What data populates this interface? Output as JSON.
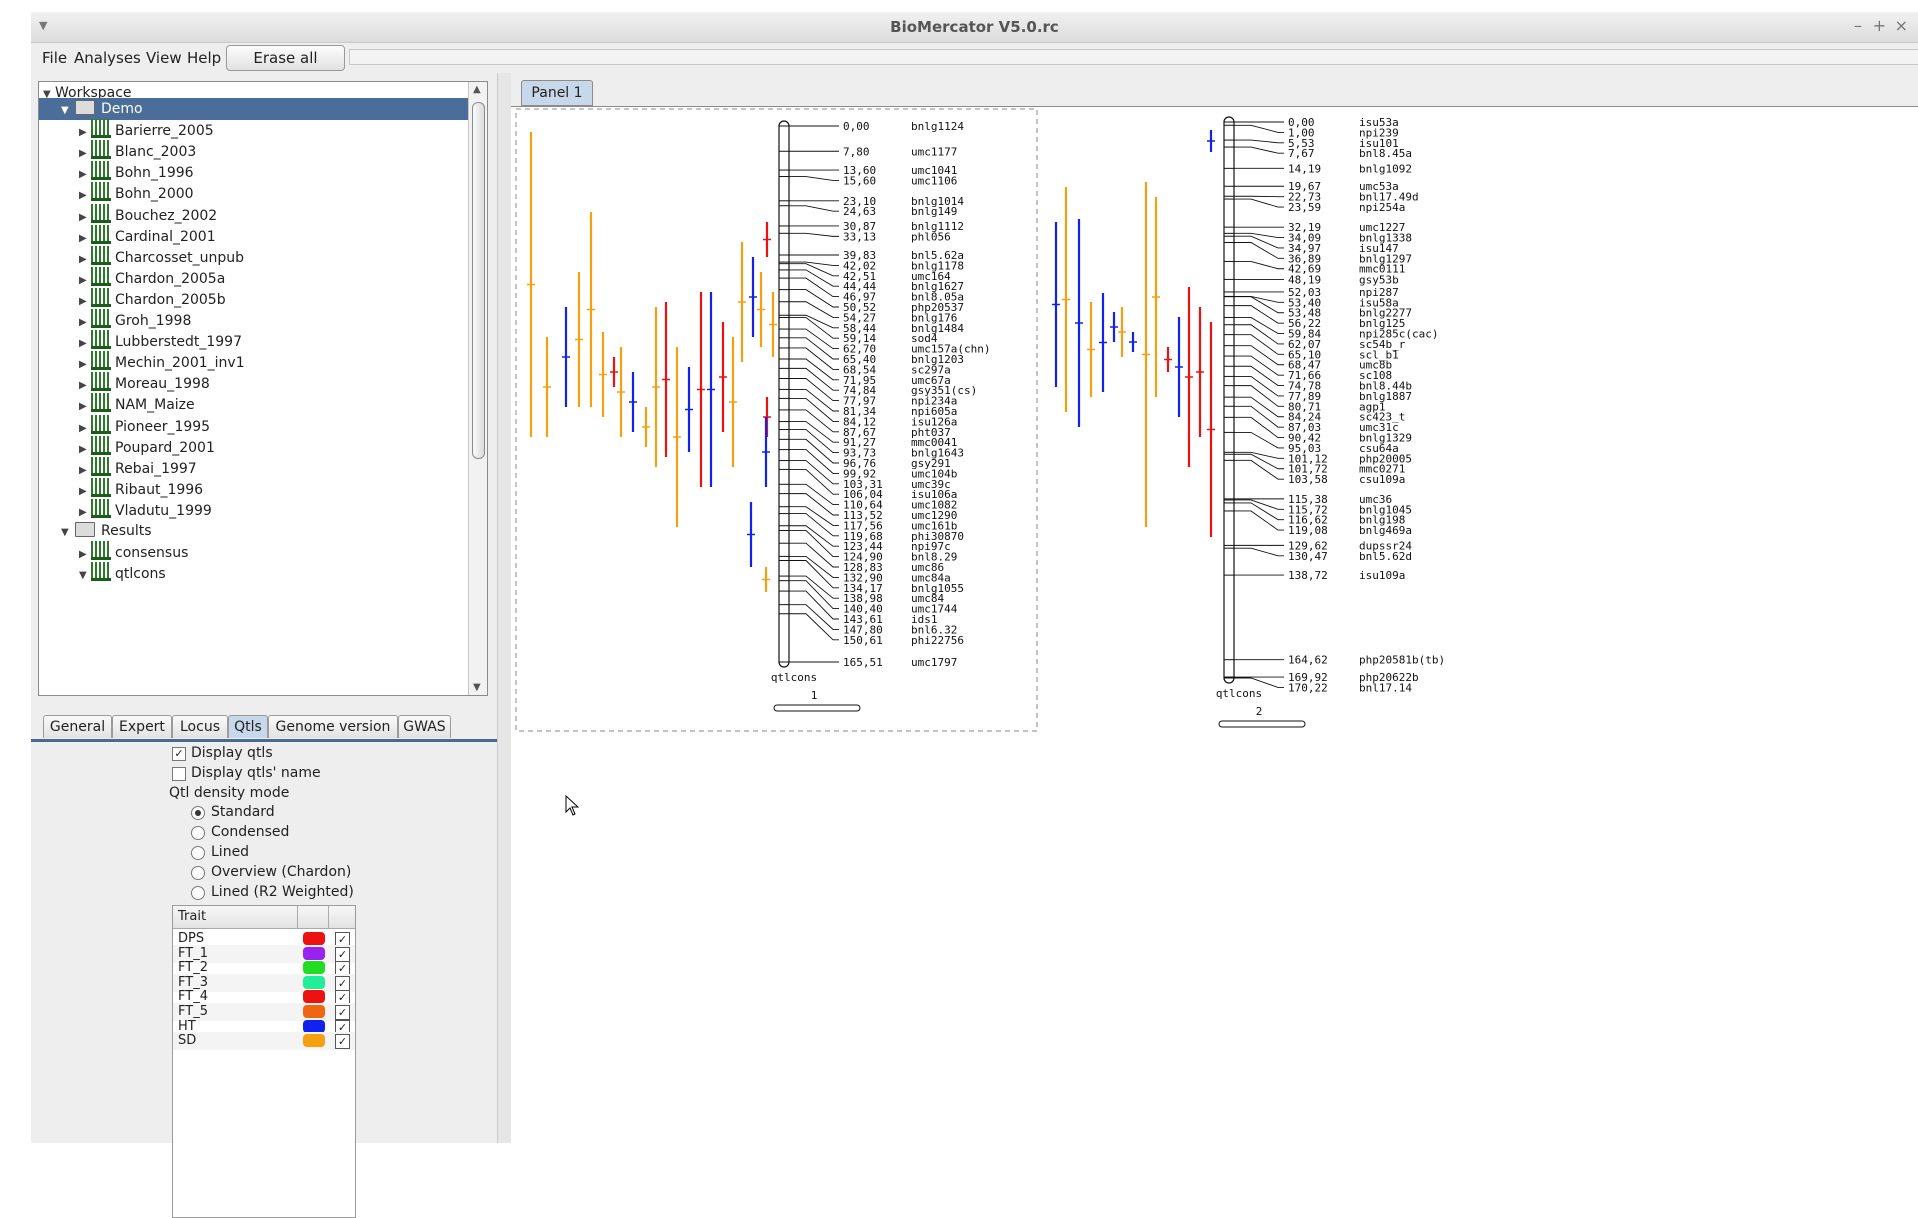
{
  "window": {
    "title": "BioMercator V5.0.rc"
  },
  "menu": {
    "items": [
      "File",
      "Analyses",
      "View",
      "Help"
    ],
    "erase_label": "Erase all"
  },
  "tree": {
    "root": "Workspace",
    "demo": "Demo",
    "datasets": [
      "Barierre_2005",
      "Blanc_2003",
      "Bohn_1996",
      "Bohn_2000",
      "Bouchez_2002",
      "Cardinal_2001",
      "Charcosset_unpub",
      "Chardon_2005a",
      "Chardon_2005b",
      "Groh_1998",
      "Lubberstedt_1997",
      "Mechin_2001_inv1",
      "Moreau_1998",
      "NAM_Maize",
      "Pioneer_1995",
      "Poupard_2001",
      "Rebai_1997",
      "Ribaut_1996",
      "Vladutu_1999"
    ],
    "results": "Results",
    "result_items": [
      "consensus",
      "qtlcons"
    ]
  },
  "tabs": [
    "General",
    "Expert",
    "Locus",
    "Qtls",
    "Genome version",
    "GWAS"
  ],
  "active_tab": "Qtls",
  "qtls_panel": {
    "display_qtls": "Display qtls",
    "display_qtls_checked": true,
    "display_names": "Display qtls' name",
    "display_names_checked": false,
    "density_label": "Qtl density mode",
    "modes": [
      "Standard",
      "Condensed",
      "Lined",
      "Overview (Chardon)",
      "Lined (R2 Weighted)"
    ],
    "selected_mode": "Standard"
  },
  "trait_table": {
    "header": "Trait",
    "rows": [
      {
        "name": "DPS",
        "color": "#ee1111"
      },
      {
        "name": "FT_1",
        "color": "#9922ee"
      },
      {
        "name": "FT_2",
        "color": "#22dd22"
      },
      {
        "name": "FT_3",
        "color": "#22ee99"
      },
      {
        "name": "FT_4",
        "color": "#ee1111"
      },
      {
        "name": "FT_5",
        "color": "#ee6611"
      },
      {
        "name": "HT",
        "color": "#1122ee"
      },
      {
        "name": "SD",
        "color": "#f5a011"
      }
    ]
  },
  "panel_tab": "Panel 1",
  "maps": [
    {
      "name": "qtlcons",
      "number": "1",
      "markers": [
        [
          "0,00",
          "bnlg1124"
        ],
        [
          "7,80",
          "umc1177"
        ],
        [
          "13,60",
          "umc1041"
        ],
        [
          "15,60",
          "umc1106"
        ],
        [
          "23,10",
          "bnlg1014"
        ],
        [
          "24,63",
          "bnlg149"
        ],
        [
          "30,87",
          "bnlg1112"
        ],
        [
          "33,13",
          "phl056"
        ],
        [
          "39,83",
          "bnl5.62a"
        ],
        [
          "42,02",
          "bnlg1178"
        ],
        [
          "42,51",
          "umc164"
        ],
        [
          "44,44",
          "bnlg1627"
        ],
        [
          "46,97",
          "bnl8.05a"
        ],
        [
          "50,52",
          "php20537"
        ],
        [
          "54,27",
          "bnlg176"
        ],
        [
          "58,44",
          "bnlg1484"
        ],
        [
          "59,14",
          "sod4"
        ],
        [
          "62,70",
          "umc157a(chn)"
        ],
        [
          "65,40",
          "bnlg1203"
        ],
        [
          "68,54",
          "sc297a"
        ],
        [
          "71,95",
          "umc67a"
        ],
        [
          "74,84",
          "gsy351(cs)"
        ],
        [
          "77,97",
          "npi234a"
        ],
        [
          "81,34",
          "npi605a"
        ],
        [
          "84,12",
          "isu126a"
        ],
        [
          "87,67",
          "pht037"
        ],
        [
          "91,27",
          "mmc0041"
        ],
        [
          "93,73",
          "bnlg1643"
        ],
        [
          "96,76",
          "gsy291"
        ],
        [
          "99,92",
          "umc104b"
        ],
        [
          "103,31",
          "umc39c"
        ],
        [
          "106,04",
          "isu106a"
        ],
        [
          "110,64",
          "umc1082"
        ],
        [
          "113,52",
          "umc1290"
        ],
        [
          "117,56",
          "umc161b"
        ],
        [
          "119,68",
          "phi30870"
        ],
        [
          "123,44",
          "npi97c"
        ],
        [
          "124,90",
          "bnl8.29"
        ],
        [
          "128,83",
          "umc86"
        ],
        [
          "132,90",
          "umc84a"
        ],
        [
          "134,17",
          "bnlg1055"
        ],
        [
          "138,98",
          "umc84"
        ],
        [
          "140,40",
          "umc1744"
        ],
        [
          "143,61",
          "ids1"
        ],
        [
          "147,80",
          "bnl6.32"
        ],
        [
          "150,61",
          "phi22756"
        ],
        [
          "165,51",
          "umc1797"
        ]
      ]
    },
    {
      "name": "qtlcons",
      "number": "2",
      "markers": [
        [
          "0,00",
          "isu53a"
        ],
        [
          "1,00",
          "npi239"
        ],
        [
          "5,53",
          "isu101"
        ],
        [
          "7,67",
          "bnl8.45a"
        ],
        [
          "14,19",
          "bnlg1092"
        ],
        [
          "19,67",
          "umc53a"
        ],
        [
          "22,73",
          "bnl17.49d"
        ],
        [
          "23,59",
          "npi254a"
        ],
        [
          "32,19",
          "umc1227"
        ],
        [
          "34,09",
          "bnlg1338"
        ],
        [
          "34,97",
          "isu147"
        ],
        [
          "36,89",
          "bnlg1297"
        ],
        [
          "42,69",
          "mmc0111"
        ],
        [
          "48,19",
          "gsy53b"
        ],
        [
          "52,03",
          "npi287"
        ],
        [
          "53,40",
          "isu58a"
        ],
        [
          "53,48",
          "bnlg2277"
        ],
        [
          "56,22",
          "bnlg125"
        ],
        [
          "59,84",
          "npi285c(cac)"
        ],
        [
          "62,07",
          "sc54b_r"
        ],
        [
          "65,10",
          "scl_b1"
        ],
        [
          "68,47",
          "umc8b"
        ],
        [
          "71,66",
          "sc108"
        ],
        [
          "74,78",
          "bnl8.44b"
        ],
        [
          "77,89",
          "bnlg1887"
        ],
        [
          "80,71",
          "agp1"
        ],
        [
          "84,24",
          "sc423_t"
        ],
        [
          "87,03",
          "umc31c"
        ],
        [
          "90,42",
          "bnlg1329"
        ],
        [
          "95,03",
          "csu64a"
        ],
        [
          "101,12",
          "php20005"
        ],
        [
          "101,72",
          "mmc0271"
        ],
        [
          "103,58",
          "csu109a"
        ],
        [
          "115,38",
          "umc36"
        ],
        [
          "115,72",
          "bnlg1045"
        ],
        [
          "116,62",
          "bnlg198"
        ],
        [
          "119,08",
          "bnlg469a"
        ],
        [
          "129,62",
          "dupssr24"
        ],
        [
          "130,47",
          "bnl5.62d"
        ],
        [
          "138,72",
          "isu109a"
        ],
        [
          "164,62",
          "php20581b(tb)"
        ],
        [
          "169,92",
          "php20622b"
        ],
        [
          "170,22",
          "bnl17.14"
        ]
      ]
    }
  ]
}
